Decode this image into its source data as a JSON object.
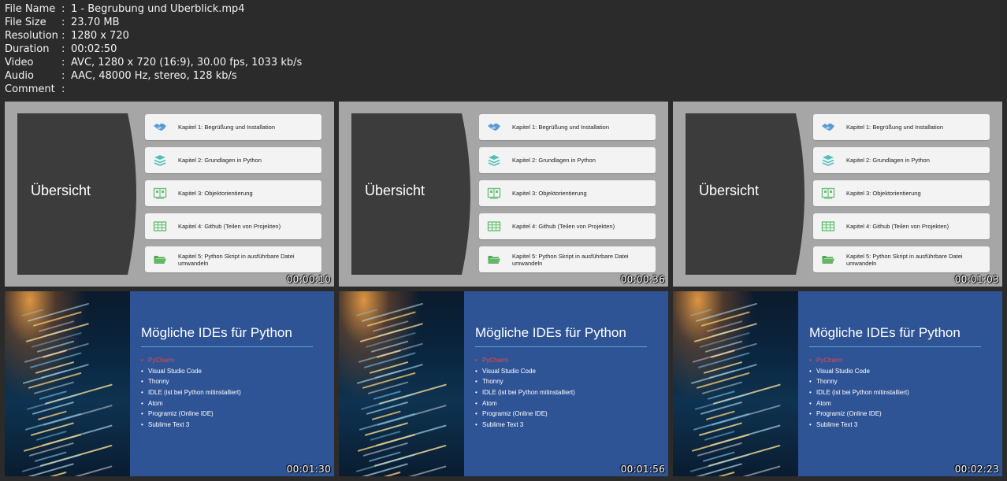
{
  "metadata": [
    {
      "label": "File Name",
      "value": "1 - Begrubung und Uberblick.mp4"
    },
    {
      "label": "File Size",
      "value": "23.70 MB"
    },
    {
      "label": "Resolution",
      "value": "1280 x 720"
    },
    {
      "label": "Duration",
      "value": "00:02:50"
    },
    {
      "label": "Video",
      "value": "AVC, 1280 x 720 (16:9), 30.00 fps, 1033 kb/s"
    },
    {
      "label": "Audio",
      "value": "AAC, 48000 Hz, stereo, 128 kb/s"
    },
    {
      "label": "Comment",
      "value": ""
    }
  ],
  "overview_slide": {
    "title": "Übersicht",
    "items": [
      {
        "label": "Kapitel 1: Begrüßung und Installation",
        "icon": "handshake-icon",
        "color": "#5b9bd5"
      },
      {
        "label": "Kapitel 2: Grundlagen in Python",
        "icon": "stack-icon",
        "color": "#4fc1b8"
      },
      {
        "label": "Kapitel 3: Objektorientierung",
        "icon": "book-icon",
        "color": "#6cc17a"
      },
      {
        "label": "Kapitel 4: Github (Teilen von Projekten)",
        "icon": "table-icon",
        "color": "#5cbf6a"
      },
      {
        "label": "Kapitel 5: Python Skript in ausführbare Datei umwandeln",
        "icon": "folder-icon",
        "color": "#4caa4c"
      }
    ]
  },
  "ide_slide": {
    "title": "Mögliche IDEs für Python",
    "items": [
      {
        "label": "PyCharm",
        "active": true
      },
      {
        "label": "Visual Studio Code",
        "active": false
      },
      {
        "label": "Thonny",
        "active": false
      },
      {
        "label": "IDLE (ist bei Python mitinstalliert)",
        "active": false
      },
      {
        "label": "Atom",
        "active": false
      },
      {
        "label": "Programiz (Online IDE)",
        "active": false
      },
      {
        "label": "Sublime Text 3",
        "active": false
      }
    ]
  },
  "thumbnails": [
    {
      "type": "overview",
      "timestamp": "00:00:10"
    },
    {
      "type": "overview",
      "timestamp": "00:00:36"
    },
    {
      "type": "overview",
      "timestamp": "00:01:03"
    },
    {
      "type": "ide",
      "timestamp": "00:01:30"
    },
    {
      "type": "ide",
      "timestamp": "00:01:56"
    },
    {
      "type": "ide",
      "timestamp": "00:02:23"
    }
  ],
  "colors": {
    "background": "#2b2b2b",
    "overview_bg": "#a6a6a6",
    "overview_panel": "#3c3c3c",
    "ide_bg": "#2f5496",
    "ide_accent": "#5aa8d8",
    "ide_active": "#e8474a"
  }
}
